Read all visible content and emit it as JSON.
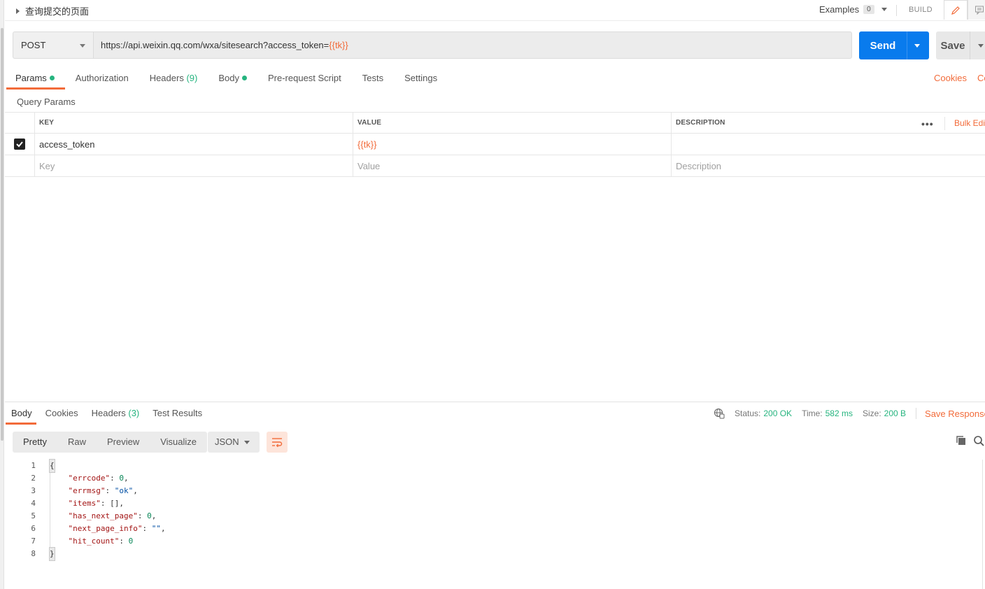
{
  "request": {
    "title": "查询提交的页面",
    "examples_label": "Examples",
    "examples_count": "0",
    "build_label": "BUILD",
    "method": "POST",
    "url_prefix": "https://api.weixin.qq.com/wxa/sitesearch?access_token=",
    "url_variable": "{{tk}}",
    "send_label": "Send",
    "save_label": "Save"
  },
  "request_tabs": [
    {
      "label": "Params",
      "dot": true,
      "count": ""
    },
    {
      "label": "Authorization",
      "dot": false,
      "count": ""
    },
    {
      "label": "Headers",
      "dot": false,
      "count": "(9)"
    },
    {
      "label": "Body",
      "dot": true,
      "count": ""
    },
    {
      "label": "Pre-request Script",
      "dot": false,
      "count": ""
    },
    {
      "label": "Tests",
      "dot": false,
      "count": ""
    },
    {
      "label": "Settings",
      "dot": false,
      "count": ""
    }
  ],
  "tab_links": {
    "cookies": "Cookies",
    "code": "Code"
  },
  "params": {
    "section_title": "Query Params",
    "columns": {
      "key": "KEY",
      "value": "VALUE",
      "description": "DESCRIPTION"
    },
    "more_label": "•••",
    "bulk_edit": "Bulk Edit",
    "row": {
      "key": "access_token",
      "value": "{{tk}}",
      "description": ""
    },
    "placeholders": {
      "key": "Key",
      "value": "Value",
      "description": "Description"
    }
  },
  "response": {
    "tabs": [
      {
        "label": "Body",
        "count": ""
      },
      {
        "label": "Cookies",
        "count": ""
      },
      {
        "label": "Headers",
        "count": "(3)"
      },
      {
        "label": "Test Results",
        "count": ""
      }
    ],
    "status_label": "Status:",
    "status_value": "200 OK",
    "time_label": "Time:",
    "time_value": "582 ms",
    "size_label": "Size:",
    "size_value": "200 B",
    "save_response": "Save Response",
    "view_modes": [
      "Pretty",
      "Raw",
      "Preview",
      "Visualize"
    ],
    "format": "JSON",
    "code_lines": [
      {
        "n": "1",
        "text": "{"
      },
      {
        "n": "2",
        "text": "    \"errcode\": 0,"
      },
      {
        "n": "3",
        "text": "    \"errmsg\": \"ok\","
      },
      {
        "n": "4",
        "text": "    \"items\": [],"
      },
      {
        "n": "5",
        "text": "    \"has_next_page\": 0,"
      },
      {
        "n": "6",
        "text": "    \"next_page_info\": \"\","
      },
      {
        "n": "7",
        "text": "    \"hit_count\": 0"
      },
      {
        "n": "8",
        "text": "}"
      }
    ]
  },
  "colors": {
    "accent": "#f26b3a",
    "send": "#097bed",
    "status_ok": "#26b47f"
  }
}
